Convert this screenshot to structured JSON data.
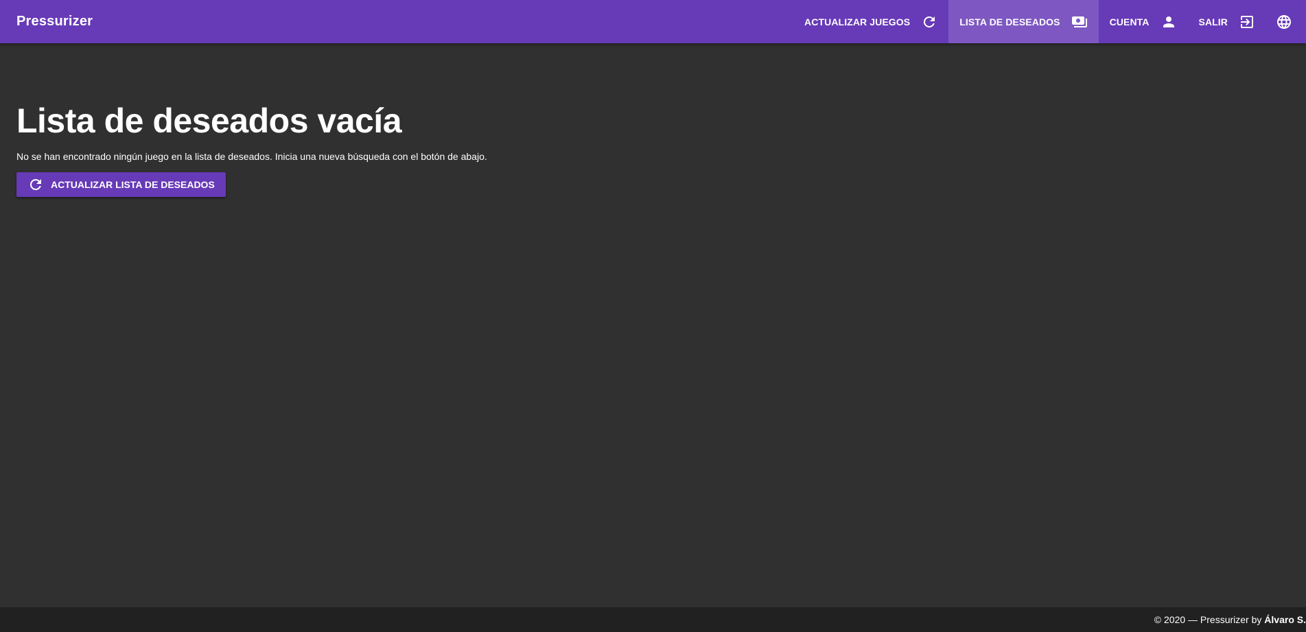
{
  "app": {
    "title": "Pressurizer"
  },
  "nav": {
    "update_games": {
      "label": "ACTUALIZAR JUEGOS",
      "icon": "refresh-icon"
    },
    "wishlist": {
      "label": "LISTA DE DESEADOS",
      "icon": "money-icon",
      "active": true
    },
    "account": {
      "label": "CUENTA",
      "icon": "person-icon"
    },
    "logout": {
      "label": "SALIR",
      "icon": "exit-icon"
    },
    "language": {
      "icon": "globe-icon"
    }
  },
  "main": {
    "heading": "Lista de deseados vacía",
    "description": "No se han encontrado ningún juego en la lista de deseados. Inicia una nueva búsqueda con el botón de abajo.",
    "refresh_button": {
      "label": "ACTUALIZAR LISTA DE DESEADOS",
      "icon": "refresh-icon"
    }
  },
  "footer": {
    "prefix": "© 2020 — Pressurizer by ",
    "author": "Álvaro S."
  },
  "colors": {
    "primary": "#673ab7",
    "primary_active": "#7e57c2",
    "background": "#303030",
    "footer_background": "#212121",
    "text": "#ffffff"
  }
}
